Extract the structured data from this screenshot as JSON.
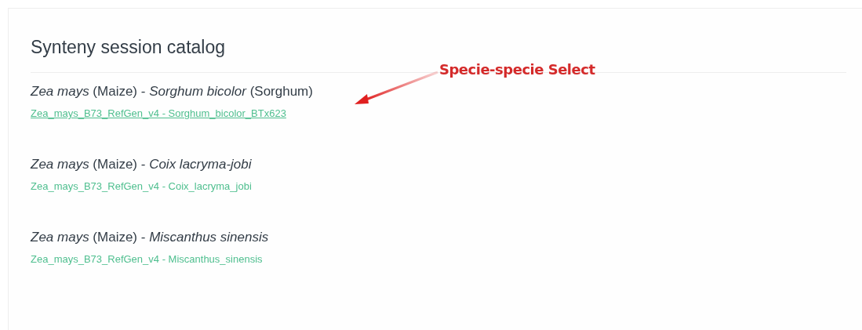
{
  "heading": "Synteny session catalog",
  "sessions": [
    {
      "title": "*Zea mays* (Maize) - *Sorghum bicolor* (Sorghum)",
      "link": "Zea_mays_B73_RefGen_v4 - Sorghum_bicolor_BTx623",
      "hovered": true
    },
    {
      "title": "*Zea mays* (Maize) - *Coix lacryma-jobi*",
      "link": "Zea_mays_B73_RefGen_v4 - Coix_lacryma_jobi",
      "hovered": false
    },
    {
      "title": "*Zea mays* (Maize) - *Miscanthus sinensis*",
      "link": "Zea_mays_B73_RefGen_v4 - Miscanthus_sinensis",
      "hovered": false
    }
  ],
  "annotation": {
    "text": "Specie-specie Select"
  }
}
